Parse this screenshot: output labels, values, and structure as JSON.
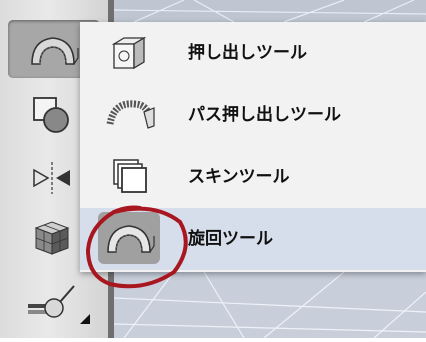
{
  "toolbar": {
    "tools": [
      {
        "name": "extrude-tool",
        "icon": "extrude-arc-icon",
        "active": true
      },
      {
        "name": "shape-tool",
        "icon": "shapes-icon",
        "active": false
      },
      {
        "name": "mirror-tool",
        "icon": "mirror-icon",
        "active": false
      },
      {
        "name": "cube-tool",
        "icon": "cube-icon",
        "active": false
      },
      {
        "name": "pin-tool",
        "icon": "pin-icon",
        "active": false
      }
    ]
  },
  "menu": {
    "items": [
      {
        "label": "押し出しツール",
        "icon": "extrude-icon",
        "highlighted": false
      },
      {
        "label": "パス押し出しツール",
        "icon": "path-extrude-icon",
        "highlighted": false
      },
      {
        "label": "スキンツール",
        "icon": "skin-icon",
        "highlighted": false
      },
      {
        "label": "旋回ツール",
        "icon": "lathe-icon",
        "highlighted": true
      }
    ]
  },
  "annotation": {
    "color": "#a8161f"
  }
}
